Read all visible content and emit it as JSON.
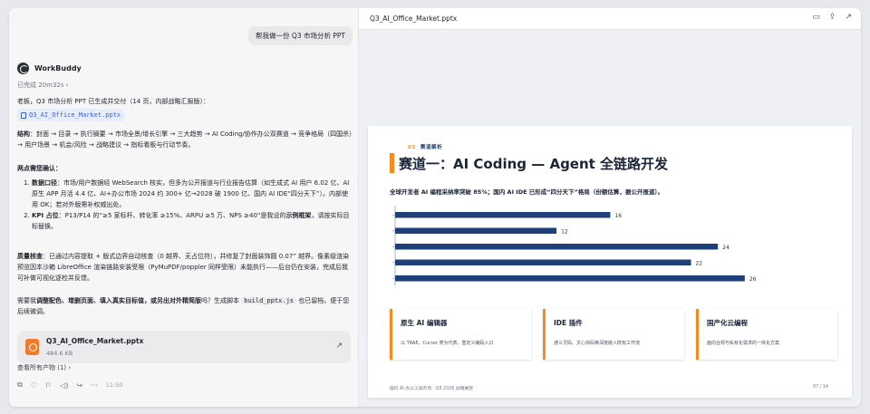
{
  "chat": {
    "user_message": "帮我做一份 Q3 市场分析 PPT",
    "agent_name": "WorkBuddy",
    "status": "已完成 20m32s",
    "intro": "老板，Q3 市场分析 PPT 已生成并交付（14 页，内部战略汇报版）：",
    "file_link": "Q3_AI_Office_Market.pptx",
    "structure_label": "结构",
    "structure_text": "：封面 → 目录 → 执行摘要 → 市场全景/增长引擎 → 三大趋势 → AI Coding/协作办公双赛道 → 竞争格局（四国杀）→ 用户场景 → 机会/风险 → 战略建议 → 指标看板与行动节奏。",
    "notes_heading": "两点需您确认：",
    "point1_label": "数据口径",
    "point1_text": "：市场/用户数据经 WebSearch 核实，但多为公开报道与行业报告估算（如生成式 AI 用户 6.02 亿、AI 原生 APP 月活 4.4 亿、AI+办公市场 2024 约 300+ 亿→2028 破 1900 亿、国内 AI IDE“四分天下”）。内部使用 OK；若对外版需补权威出处。",
    "point2_label": "KPI 占位",
    "point2_text_a": "：P13/P14 的“≥5 家标杆、转化率 ≥15%、ARPU ≥5 万、NPS ≥40”是我设的",
    "point2_bold": "示例框架",
    "point2_text_b": "，请按实际目标替换。",
    "qc_label": "质量核查",
    "qc_text": "：已通过内容提取 + 版式边界自动核查（0 越界、无占位符），并修复了封面装饰圆 0.07” 越界。像素级渲染预览因本沙箱 LibreOffice 渲染链路安装受限（PyMuPDF/poppler 同样受限）未能执行——后台仍在安装，完成后我可补做可视化逐检并反馈。",
    "ask_a": "需要我",
    "ask_bold": "调整配色、增删页面、填入真实目标值，或另出对外精简版",
    "ask_b": "吗？生成脚本",
    "ask_code": "build_pptx.js",
    "ask_c": "也已留档，便于您后续微调。",
    "attachment_name": "Q3_AI_Office_Market.pptx",
    "attachment_size": "484.6 KB",
    "all_products": "查看所有产物 (1) ›",
    "time": "11:50"
  },
  "preview": {
    "title": "Q3_AI_Office_Market.pptx"
  },
  "slide": {
    "kicker_num": "03",
    "kicker_text": "赛道解析",
    "heading": "赛道一：AI Coding — Agent 全链路开发",
    "subheading": "全球开发者 AI 编程采纳率突破 85%；国内 AI IDE 已形成“四分天下”格局（份额估算，据公开报道）。",
    "cards": [
      {
        "title": "原生 AI 编辑器",
        "body": "以 TRAE、Cursor 类为代表，重定义编码入口"
      },
      {
        "title": "IDE 插件",
        "body": "通义灵码、文心快码等深度嵌入既有工作流"
      },
      {
        "title": "国产化云编程",
        "body": "面向合规与私有化需求的一体化方案"
      }
    ],
    "footer_left": "国内 AI 办公工具市场 · Q3 2026 战略展望",
    "footer_right": "07 / 14"
  },
  "colors": {
    "bar": "#1f3f78",
    "accent": "#f28c1f"
  },
  "chart_data": {
    "type": "bar",
    "orientation": "horizontal",
    "values": [
      16,
      12,
      24,
      22,
      26
    ],
    "xlim": [
      0,
      30
    ],
    "grid": false
  }
}
